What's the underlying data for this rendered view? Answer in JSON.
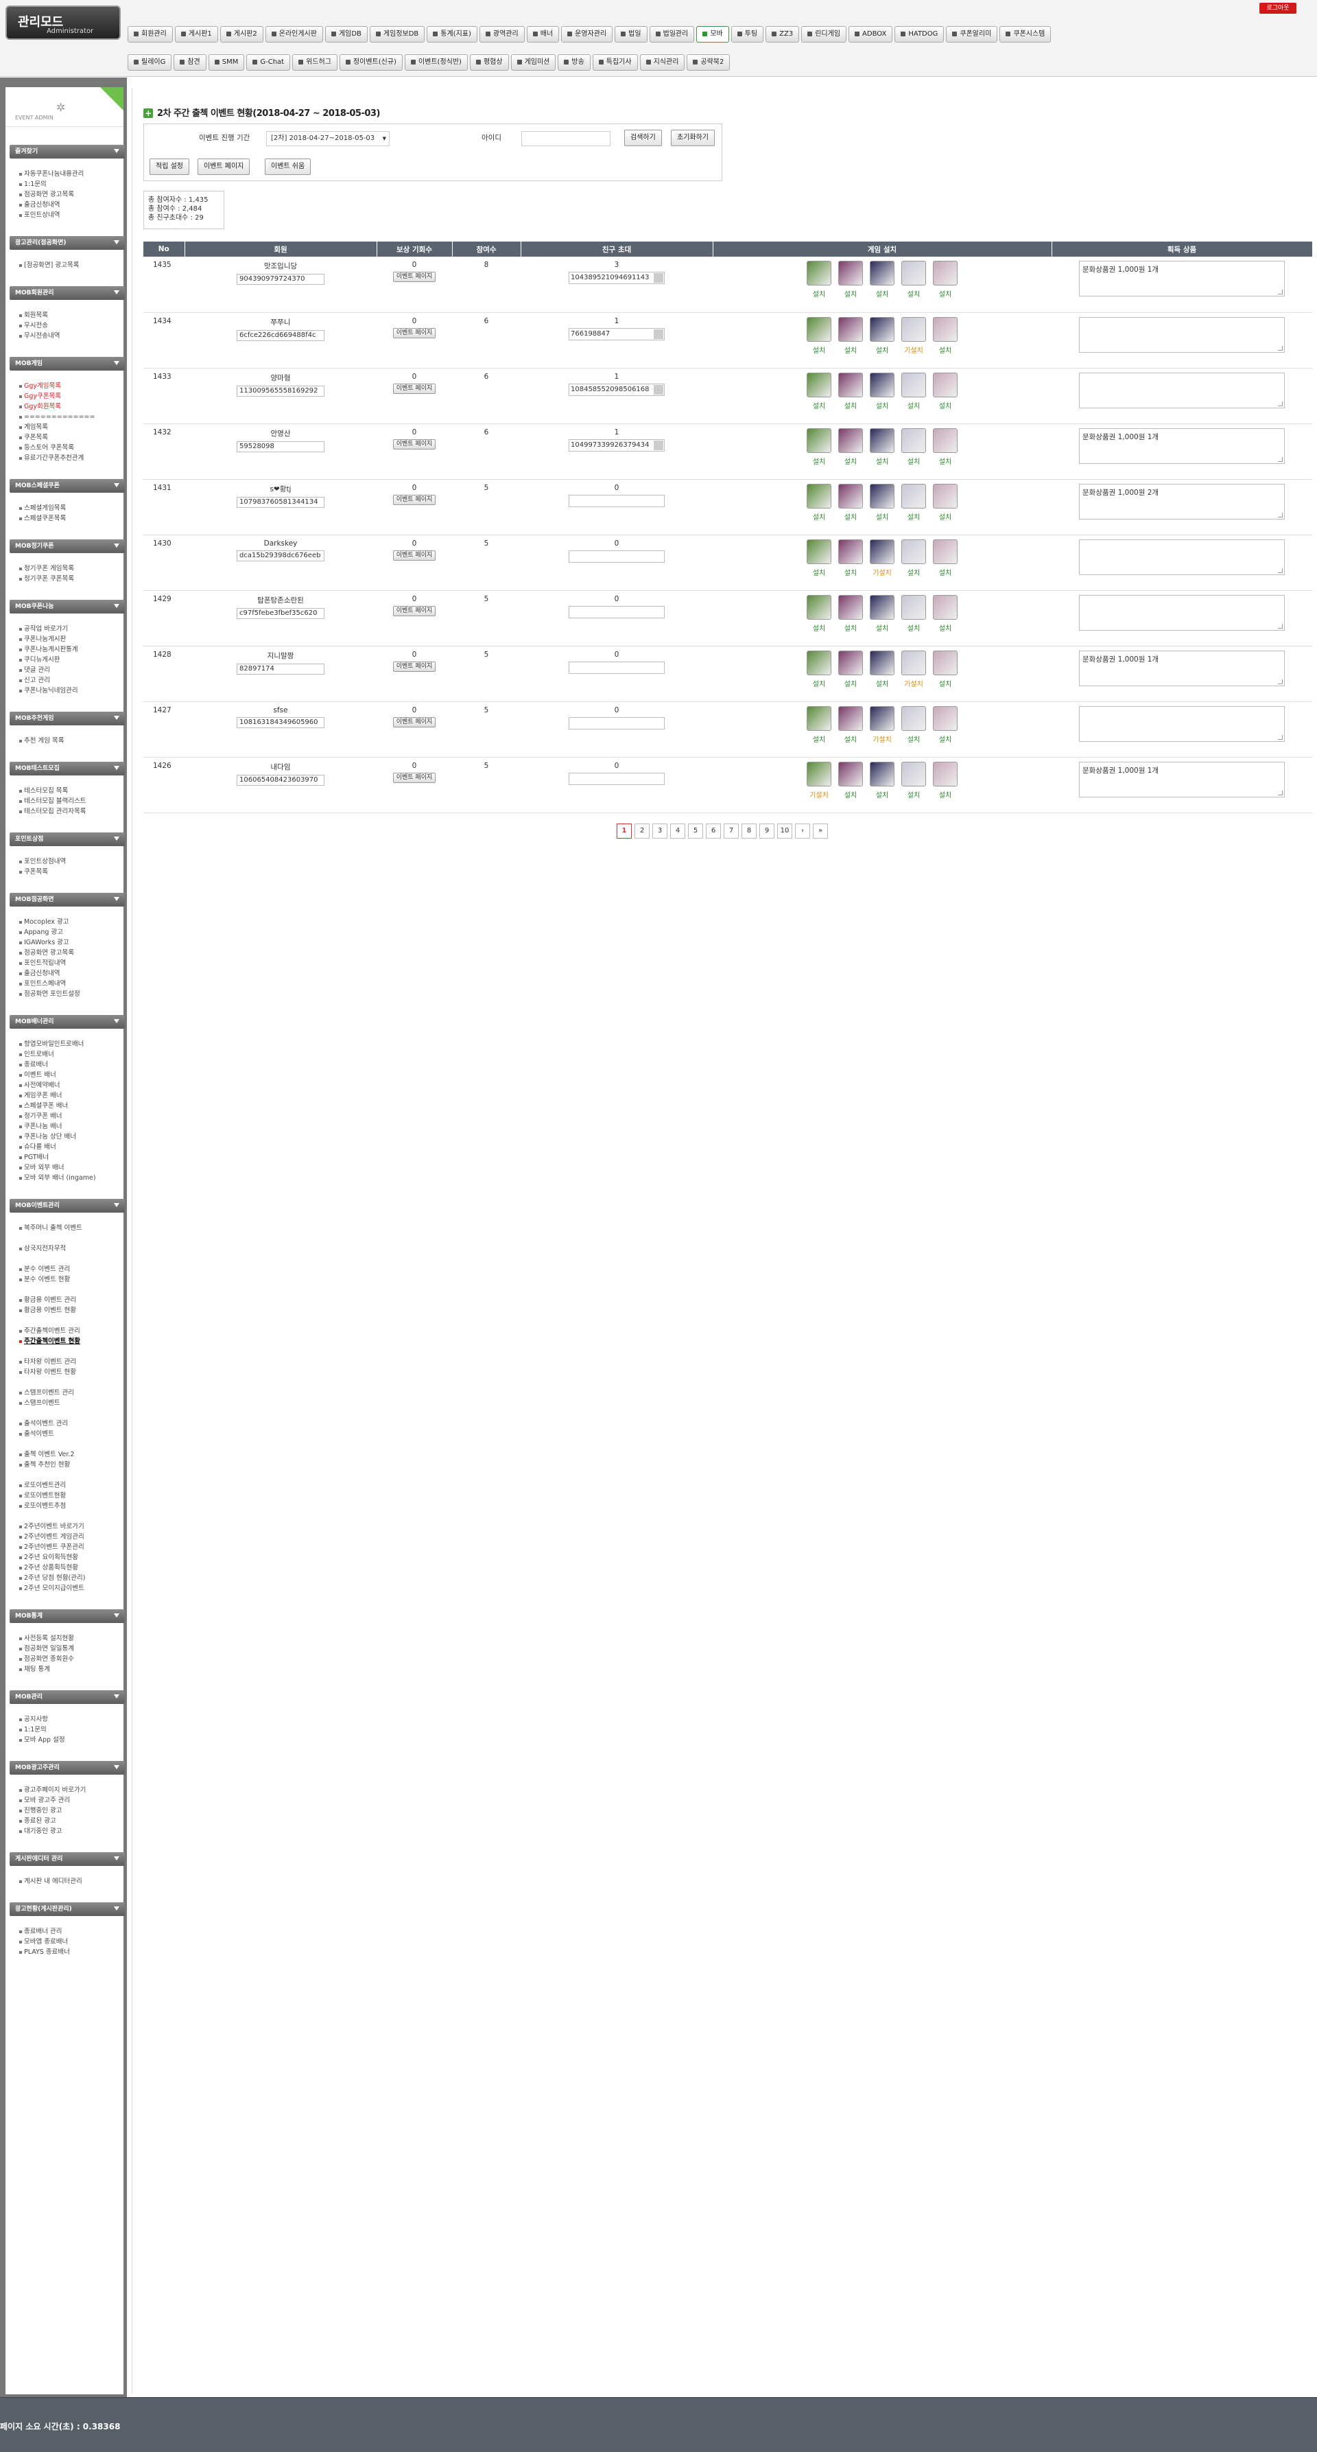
{
  "header": {
    "logo_title": "관리모드",
    "logo_subtitle": "Administrator",
    "logout": "로그아웃"
  },
  "nav_row1": [
    "회원관리",
    "게시판1",
    "게시판2",
    "온라인게시판",
    "게임DB",
    "게임정보DB",
    "통계(지표)",
    "광역관리",
    "배너",
    "운영자관리",
    "법일",
    "법일관리",
    "모바",
    "투팅",
    "ZZ3",
    "린디게임",
    "ADBOX",
    "HATDOG",
    "쿠폰알리미",
    "쿠폰시스템"
  ],
  "nav_row1_active": 12,
  "nav_row2": [
    "릴레이G",
    "참견",
    "SMM",
    "G-Chat",
    "위드허그",
    "정이벤트(신규)",
    "이벤트(정식반)",
    "평협상",
    "게임미션",
    "방송",
    "특집기사",
    "지식관리",
    "공략북2"
  ],
  "sidebar": {
    "event_admin": "EVENT ADMIN",
    "sections": [
      {
        "title": "즐겨찾기",
        "items": [
          "자동쿠폰나눔내용관리",
          "1:1문의",
          "점공화면 광고목록",
          "출금신청내역",
          "포인트상내역"
        ]
      },
      {
        "title": "광고관리(점공화면)",
        "items": [
          "[점공화면] 광고목록"
        ]
      },
      {
        "title": "MOB회원관리",
        "items": [
          "회원목록",
          "무시전송",
          "무시전송내역"
        ]
      },
      {
        "title": "MOB게임",
        "items": [
          "Ggy게임목록",
          "Ggy쿠폰목록",
          "Ggy회원목록",
          "=============",
          "게임목록",
          "쿠폰목록",
          "등스토어 쿠폰목록",
          "유료기간쿠폰추천관계"
        ]
      },
      {
        "title": "MOB스페셜쿠폰",
        "items": [
          "스페셜게임목록",
          "스페셜쿠폰목록"
        ]
      },
      {
        "title": "MOB정기쿠폰",
        "items": [
          "정기쿠폰 게임목록",
          "정기쿠폰 쿠폰목록"
        ]
      },
      {
        "title": "MOB쿠폰나눔",
        "items": [
          "공작업 바로가기",
          "쿠폰나눔게시판",
          "쿠폰나눔게시판통계",
          "쿠디뉴게시판",
          "댓글 관리",
          "신고 관리",
          "쿠폰나눔닉네임관리"
        ]
      },
      {
        "title": "MOB추천게임",
        "items": [
          "추천 게임 목록"
        ]
      },
      {
        "title": "MOB테스트모집",
        "items": [
          "테스터모집 목록",
          "테스터모집 블랙리스트",
          "테스터모집 관리자목록"
        ]
      },
      {
        "title": "포인트상점",
        "items": [
          "포인트상점내역",
          "쿠폰목록"
        ]
      },
      {
        "title": "MOB점공화면",
        "items": [
          "Mocoplex 광고",
          "Appang 광고",
          "IGAWorks 광고",
          "점공화면 광고목록",
          "포인트적립내역",
          "출금신청내역",
          "포인트스페내역",
          "점공화면 포인트설정"
        ]
      },
      {
        "title": "MOB배너관리",
        "items": [
          "향엽모바일인트로배너",
          "인트로배너",
          "종료배너",
          "이벤트 배너",
          "사전예약배너",
          "게임쿠폰 배너",
          "스페셜쿠폰 배너",
          "정기쿠폰 배너",
          "쿠폰나눔 배너",
          "쿠폰나눔 상단 배너",
          "슈다롤 배너",
          "PGT배너",
          "모바 외부 배너",
          "모바 외부 배너 (ingame)"
        ]
      },
      {
        "title": "MOB이벤트관리",
        "items": [
          "복주머니 출첵 이벤트",
          "",
          "삼국지전차무적",
          "",
          "분수 이벤트 관리",
          "분수 이벤트 현황",
          "",
          "황금용 이벤트 관리",
          "황금용 이벤트 현황",
          "",
          "주간출첵이벤트 관리",
          "주간출첵이벤트 현황",
          "",
          "타자왕 이벤트 관리",
          "타자왕 이벤트 현황",
          "",
          "스탬프이벤트 관리",
          "스탬프이벤트",
          "",
          "출석이벤트 관리",
          "출석이벤트",
          "",
          "출첵 이벤트 Ver.2",
          "출첵 추천인 현황",
          "",
          "로또이벤트관리",
          "로또이벤트현황",
          "로또이벤트추첨",
          "",
          "2주년이벤트 바로가기",
          "2주년이벤트 게임관리",
          "2주년이벤트 쿠폰관리",
          "2주년 요이획득현황",
          "2주년 상품획득현황",
          "2주년 당첨 현황(관리)",
          "2주년 모이지급이벤트"
        ]
      },
      {
        "title": "MOB통계",
        "items": [
          "사전등록 설치현황",
          "점공화면 일일통계",
          "점공화면 종회원수",
          "채팅 통계"
        ]
      },
      {
        "title": "MOB관리",
        "items": [
          "공지사항",
          "1:1문의",
          "모바 App 설정"
        ]
      },
      {
        "title": "MOB광고주관리",
        "items": [
          "광고주페이지 바로가기",
          "모바 광고주 관리",
          "진행중인 광고",
          "종료된 광고",
          "대기중인 광고"
        ]
      },
      {
        "title": "게시판에디터 관리",
        "items": [
          "게시판 내 에디터관리"
        ]
      },
      {
        "title": "광고현황(게시판관리)",
        "items": [
          "종료배너 관리",
          "모바앱 종료배너",
          "PLAYS 종료배너"
        ]
      }
    ],
    "current_item": "주간출첵이벤트 현황",
    "red_items": [
      "Ggy게임목록",
      "Ggy쿠폰목록",
      "Ggy회원목록"
    ]
  },
  "page": {
    "title": "2차 주간 출첵 이벤트 현황(2018-04-27 ~ 2018-05-03)",
    "filter": {
      "period_label": "이벤트 진행 기간",
      "period_value": "[2차] 2018-04-27~2018-05-03",
      "id_label": "아이디",
      "id_value": "",
      "search_btn": "검색하기",
      "reset_btn": "초기화하기"
    },
    "action_buttons": [
      "적립 설정",
      "이벤트 페이지",
      "이벤트 쉬움"
    ],
    "stats": [
      "총 참여자수 : 1,435",
      "총 참여수 : 2,484",
      "총 친구초대수 : 29"
    ]
  },
  "table": {
    "headers": [
      "No",
      "회원",
      "보상 기회수",
      "참여수",
      "친구 초대",
      "게임 설치",
      "획득 상품"
    ],
    "event_page_btn": "이벤트 페이지",
    "rows": [
      {
        "no": "1435",
        "nick": "맛조입니당",
        "id": "904390979724370",
        "reward": "0",
        "part": "8",
        "invite": "3",
        "invite_id": "104389521094691143",
        "games": [
          "설치",
          "설치",
          "설치",
          "설치",
          "설치"
        ],
        "prize": "문화상품권 1,000원 1개"
      },
      {
        "no": "1434",
        "nick": "쭈쭈니",
        "id": "6cfce226cd669488f4c",
        "reward": "0",
        "part": "6",
        "invite": "1",
        "invite_id": "766198847",
        "games": [
          "설치",
          "설치",
          "설치",
          "기설치",
          "설치"
        ],
        "prize": ""
      },
      {
        "no": "1433",
        "nick": "양마형",
        "id": "113009565558169292",
        "reward": "0",
        "part": "6",
        "invite": "1",
        "invite_id": "108458552098506168",
        "games": [
          "설치",
          "설치",
          "설치",
          "설치",
          "설치"
        ],
        "prize": ""
      },
      {
        "no": "1432",
        "nick": "안영산",
        "id": "59528098",
        "reward": "0",
        "part": "6",
        "invite": "1",
        "invite_id": "104997339926379434",
        "games": [
          "설치",
          "설치",
          "설치",
          "설치",
          "설치"
        ],
        "prize": "문화상품권 1,000원 1개"
      },
      {
        "no": "1431",
        "nick": "s❤황tj",
        "id": "107983760581344134",
        "reward": "0",
        "part": "5",
        "invite": "0",
        "invite_id": "",
        "games": [
          "설치",
          "설치",
          "설치",
          "설치",
          "설치"
        ],
        "prize": "문화상품권 1,000원 2개"
      },
      {
        "no": "1430",
        "nick": "Darkskey",
        "id": "dca15b29398dc676eeb",
        "reward": "0",
        "part": "5",
        "invite": "0",
        "invite_id": "",
        "games": [
          "설치",
          "설치",
          "기설치",
          "설치",
          "설치"
        ],
        "prize": ""
      },
      {
        "no": "1429",
        "nick": "탑폰탕존소란된",
        "id": "c97f5febe3fbef35c620",
        "reward": "0",
        "part": "5",
        "invite": "0",
        "invite_id": "",
        "games": [
          "설치",
          "설치",
          "설치",
          "설치",
          "설치"
        ],
        "prize": ""
      },
      {
        "no": "1428",
        "nick": "지니말짱",
        "id": "82897174",
        "reward": "0",
        "part": "5",
        "invite": "0",
        "invite_id": "",
        "games": [
          "설치",
          "설치",
          "설치",
          "기설치",
          "설치"
        ],
        "prize": "문화상품권 1,000원 1개"
      },
      {
        "no": "1427",
        "nick": "sfse",
        "id": "108163184349605960",
        "reward": "0",
        "part": "5",
        "invite": "0",
        "invite_id": "",
        "games": [
          "설치",
          "설치",
          "기설치",
          "설치",
          "설치"
        ],
        "prize": ""
      },
      {
        "no": "1426",
        "nick": "내다임",
        "id": "106065408423603970",
        "reward": "0",
        "part": "5",
        "invite": "0",
        "invite_id": "",
        "games": [
          "기설치",
          "설치",
          "설치",
          "설치",
          "설치"
        ],
        "prize": "문화상품권 1,000원 1개"
      }
    ]
  },
  "pagination": {
    "pages": [
      "1",
      "2",
      "3",
      "4",
      "5",
      "6",
      "7",
      "8",
      "9",
      "10"
    ],
    "current": "1",
    "next": "›",
    "last": "»"
  },
  "footer": {
    "load_time": "페이지 소요 시간(초) : 0.38368"
  },
  "game_icon_colors": [
    "#5a8a3a",
    "#7a3a6a",
    "#2a2a5a",
    "#c8c8d8",
    "#c8a8b8"
  ]
}
